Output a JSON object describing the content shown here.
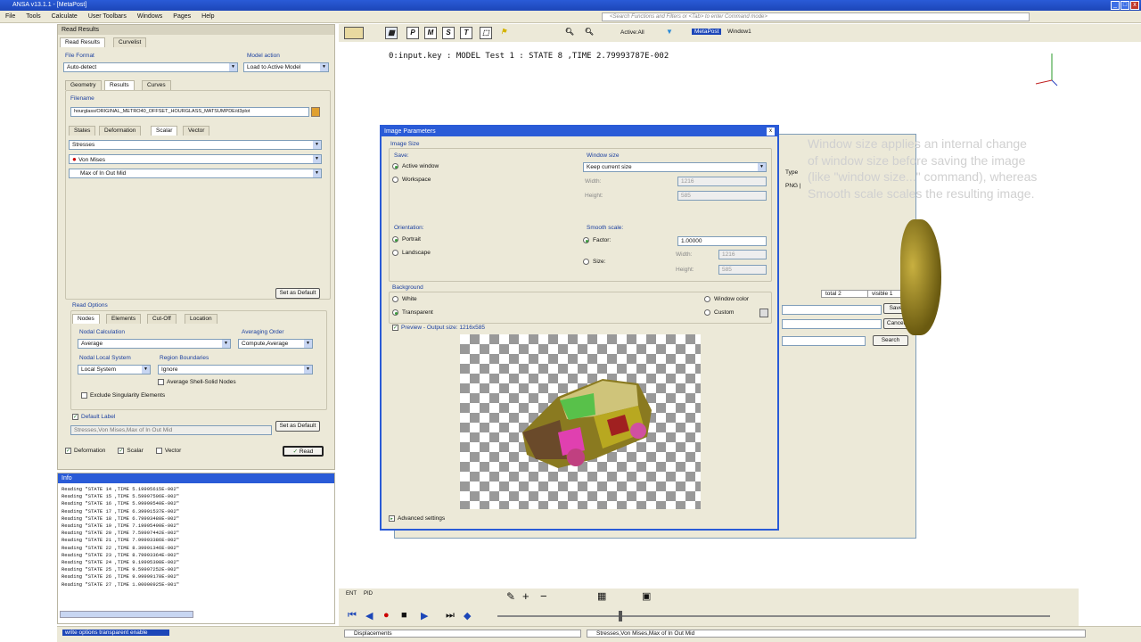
{
  "window": {
    "title": "ANSA v13.1.1 - [MetaPost]",
    "controls": [
      "_",
      "□",
      "x"
    ]
  },
  "menu": [
    "File",
    "Tools",
    "Calculate",
    "User Toolbars",
    "Windows",
    "Pages",
    "Help"
  ],
  "command_search_placeholder": "<Search Functions and Filters or <Tab> to enter Command mode>",
  "toolbar": {
    "active_label": "Active:All",
    "window_tag": "MetaPost",
    "window_name": "Window1"
  },
  "read_results": {
    "header": "Read Results",
    "top_tabs": [
      "Read Results",
      "Curvelist"
    ],
    "file_format_label": "File Format",
    "file_format_value": "Auto-detect",
    "model_action_label": "Model action",
    "model_action_value": "Load to Active Model",
    "section_tabs": [
      "Geometry",
      "Results",
      "Curves"
    ],
    "filename_label": "Filename",
    "filename_value": "hourglass/ORIGINAL_METRO40_OFFSET_HOURGLASS_MATSUMPDE/d3plot",
    "result_tabs": [
      "States",
      "Deformation",
      "Scalar",
      "Vector"
    ],
    "scalar_rows": [
      "Stresses",
      "Von Mises",
      "Max of In Out Mid"
    ],
    "set_default": "Set as Default",
    "read_options_label": "Read Options",
    "option_tabs": [
      "Nodes",
      "Elements",
      "Cut-Off",
      "Location"
    ],
    "nodal_calc_label": "Nodal Calculation",
    "nodal_calc_value": "Average",
    "averaging_order_label": "Averaging Order",
    "averaging_order_value": "Compute,Average",
    "nodal_local_label": "Nodal Local System",
    "nodal_local_value": "Local System",
    "region_label": "Region Boundaries",
    "region_value": "Ignore",
    "avg_shell_solid": "Average Shell-Solid Nodes",
    "exclude_singularity": "Exclude Singularity Elements",
    "default_label_chk": "Default Label",
    "default_label_value": "Stresses,Von Mises,Max of In Out Mid",
    "set_default_2": "Set as Default",
    "footer_items": [
      "Deformation",
      "Scalar",
      "Vector"
    ],
    "read_button": "Read"
  },
  "info": {
    "header": "Info",
    "lines": [
      "Reading \"STATE 14    ,TIME 5.19995615E-002\"",
      "Reading \"STATE 15    ,TIME 5.59997506E-002\"",
      "Reading \"STATE 16    ,TIME 5.99999540E-002\"",
      "Reading \"STATE 17    ,TIME 6.39991537E-002\"",
      "Reading \"STATE 18    ,TIME 6.79993480E-002\"",
      "Reading \"STATE 19    ,TIME 7.19995490E-002\"",
      "Reading \"STATE 20    ,TIME 7.59997442E-002\"",
      "Reading \"STATE 21    ,TIME 7.99993386E-002\"",
      "Reading \"STATE 22    ,TIME 8.39991346E-002\"",
      "Reading \"STATE 23    ,TIME 8.79993364E-002\"",
      "Reading \"STATE 24    ,TIME 9.19995308E-002\"",
      "Reading \"STATE 25    ,TIME 9.59997252E-002\"",
      "Reading \"STATE 26    ,TIME 9.99999170E-002\"",
      "Reading \"STATE 27    ,TIME 1.00000925E-001\""
    ]
  },
  "viewport": {
    "header": "0:input.key : MODEL Test 1  : STATE 8       ,TIME 2.79993787E-002"
  },
  "dialog": {
    "title": "Image Parameters",
    "image_size_label": "Image Size",
    "save_label": "Save:",
    "active_window": "Active window",
    "workspace": "Workspace",
    "window_size_label": "Window size",
    "window_size_value": "Keep current size",
    "width_label": "Width:",
    "height_label": "Height:",
    "width_value": "1216",
    "height_value": "585",
    "orientation_label": "Orientation:",
    "portrait": "Portrait",
    "landscape": "Landscape",
    "smooth_scale_label": "Smooth scale:",
    "factor_label": "Factor:",
    "factor_value": "1.00000",
    "size_label": "Size:",
    "background_label": "Background",
    "white": "White",
    "transparent": "Transparent",
    "window_color": "Window color",
    "custom": "Custom",
    "preview_label": "Preview - Output size: 1216x585",
    "advanced": "Advanced settings"
  },
  "behind_dialog": {
    "type_label": "Type",
    "png_label": "PNG |",
    "total_label": "total",
    "total_value": "2",
    "visible_label": "visible",
    "visible_value": "1",
    "save": "Save",
    "cancel": "Cancel",
    "search": "Search"
  },
  "tooltip_text": "Window size applies an internal change of window size before saving the image (like \"window size...\" command), whereas Smooth scale scales the resulting image.",
  "status": {
    "left": "write options transparent enable",
    "middle": "Displacements",
    "right": "Stresses,Von Mises,Max of In Out Mid"
  },
  "colors": {
    "title_blue": "#2a5bd7",
    "panel_bg": "#ece9d8",
    "accent_green": "#3a9a3a"
  }
}
